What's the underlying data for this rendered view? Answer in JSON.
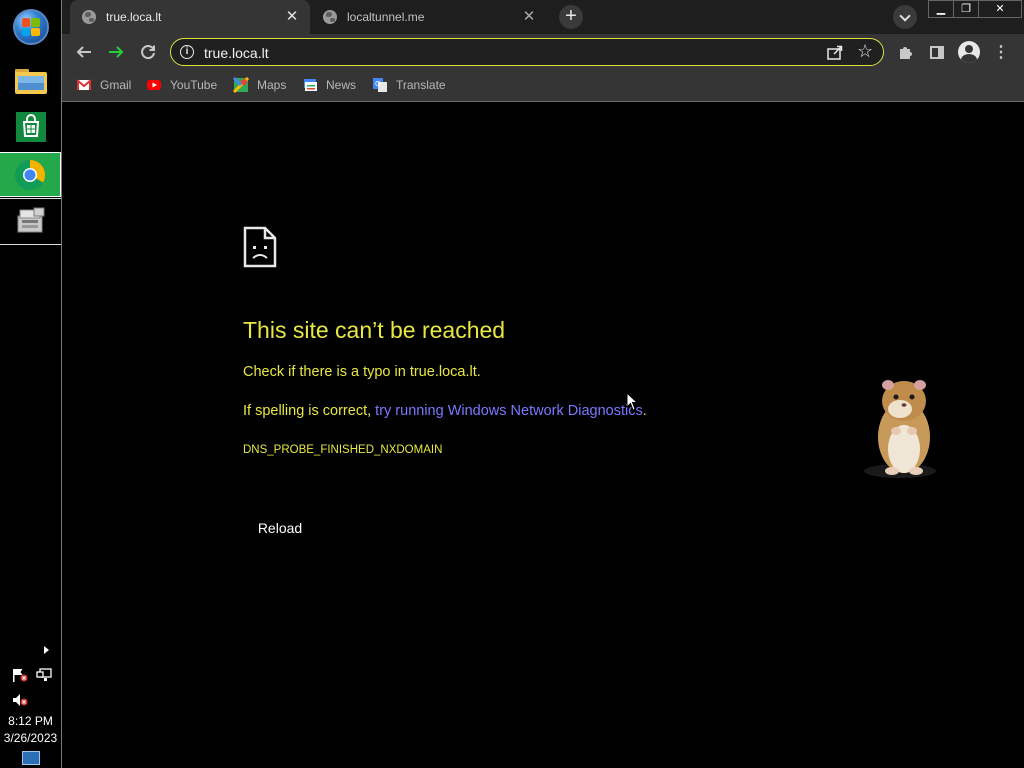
{
  "taskbar": {
    "clock_time": "8:12 PM",
    "clock_date": "3/26/2023",
    "items": [
      "start-orb",
      "file-explorer",
      "microsoft-store",
      "google-chrome",
      "network-tool"
    ]
  },
  "browser": {
    "tabs": [
      {
        "title": "true.loca.lt",
        "active": true
      },
      {
        "title": "localtunnel.me",
        "active": false
      }
    ],
    "new_tab_symbol": "+",
    "close_symbol": "✕",
    "address": "true.loca.lt",
    "bookmarks": [
      {
        "label": "Gmail",
        "icon": "gmail-icon"
      },
      {
        "label": "YouTube",
        "icon": "youtube-icon"
      },
      {
        "label": "Maps",
        "icon": "maps-icon"
      },
      {
        "label": "News",
        "icon": "news-icon"
      },
      {
        "label": "Translate",
        "icon": "translate-icon"
      }
    ],
    "window_controls": {
      "minimize": "▁",
      "maximize": "❐",
      "close": "✕"
    }
  },
  "error_page": {
    "title": "This site can’t be reached",
    "line1": "Check if there is a typo in true.loca.lt.",
    "line2_prefix": "If spelling is correct, ",
    "line2_link": "try running Windows Network Diagnostics",
    "line2_suffix": ".",
    "error_code": "DNS_PROBE_FINISHED_NXDOMAIN",
    "reload_label": "Reload"
  },
  "colors": {
    "error_text": "#e8e840",
    "link": "#7a78ff",
    "omnibox_focus": "#d9e33b",
    "forward_arrow": "#22d13a",
    "chrome_taskbar_active": "#24a94a"
  }
}
